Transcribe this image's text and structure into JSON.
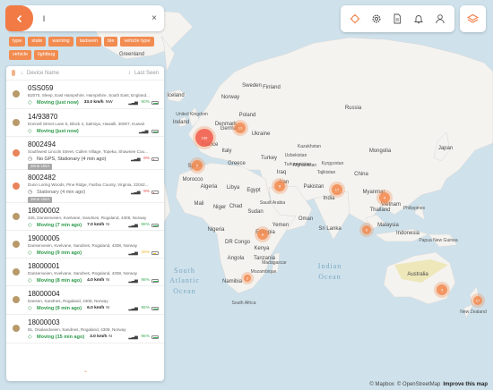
{
  "search": {
    "value": "l",
    "clear": "×"
  },
  "filters": [
    "type",
    "state",
    "warning",
    "lastseen",
    "ble",
    "vehicle type",
    "vehicle",
    "lightbug"
  ],
  "list_header": {
    "name": "Device Name",
    "last_seen": "Last Seen"
  },
  "devices": [
    {
      "id": "0SS059",
      "address": "B2070, Sleep, East Hampshire, Hampshire, South East, England...",
      "status": "Moving (just now)",
      "status_kind": "moving",
      "speed": "33.0 km/h",
      "heading": "NW",
      "battery": "90%",
      "battery_level": 0.9,
      "battery_color": "#3fae5a",
      "tag": ""
    },
    {
      "id": "14/93870",
      "address": "Donnell Street Lane 5, Block 4, Salmiya, Hawalli, 30007, Kuwait",
      "status": "Moving (just now)",
      "status_kind": "moving",
      "speed": "",
      "heading": "",
      "battery": "",
      "battery_level": 0.9,
      "battery_color": "#3fae5a",
      "tag": ""
    },
    {
      "id": "8002494",
      "address": "Southwest Lincoln Street, Cullen Village, Topeka, Shawnee Cou...",
      "status": "No GPS, Stationary (4 min ago)",
      "status_kind": "nogps",
      "speed": "",
      "heading": "",
      "battery": "9%",
      "battery_level": 0.12,
      "battery_color": "#e34a4a",
      "tag": "Jens USA"
    },
    {
      "id": "8002482",
      "address": "Dunn Loring Woods, Pine Ridge, Fairfax County, Virginia, 22042...",
      "status": "Stationary (4 min ago)",
      "status_kind": "stationary",
      "speed": "",
      "heading": "",
      "battery": "9%",
      "battery_level": 0.12,
      "battery_color": "#e34a4a",
      "tag": "Jens USA"
    },
    {
      "id": "18000002",
      "address": "345, Dansenveien, Kvelvane, Sandnes, Rogaland, 4308, Norway",
      "status": "Moving (7 min ago)",
      "status_kind": "moving",
      "speed": "7.0 km/h",
      "heading": "N",
      "battery": "98%",
      "battery_level": 0.98,
      "battery_color": "#3fae5a",
      "tag": ""
    },
    {
      "id": "19000005",
      "address": "Dansenveien, Kvelvane, Sandnes, Rogaland, 4308, Norway",
      "status": "Moving (9 min ago)",
      "status_kind": "moving",
      "speed": "",
      "heading": "",
      "battery": "49%",
      "battery_level": 0.49,
      "battery_color": "#f2b830",
      "tag": ""
    },
    {
      "id": "18000001",
      "address": "Dansenveien, Kvelvane, Sandnes, Rogaland, 4308, Norway",
      "status": "Moving (8 min ago)",
      "status_kind": "moving",
      "speed": "4.0 km/h",
      "heading": "N",
      "battery": "98%",
      "battery_level": 0.98,
      "battery_color": "#3fae5a",
      "tag": ""
    },
    {
      "id": "18000004",
      "address": "Dansen, Sandnes, Rogaland, 4308, Norway",
      "status": "Moving (9 min ago)",
      "status_kind": "moving",
      "speed": "6.0 km/h",
      "heading": "N",
      "battery": "96%",
      "battery_level": 0.96,
      "battery_color": "#3fae5a",
      "tag": ""
    },
    {
      "id": "18000003",
      "address": "91, Osalandveien, Sandnes, Rogaland, 4308, Norway",
      "status": "Moving (15 min ago)",
      "status_kind": "moving",
      "speed": "3.0 km/h",
      "heading": "N",
      "battery": "96%",
      "battery_level": 0.96,
      "battery_color": "#3fae5a",
      "tag": ""
    }
  ],
  "map": {
    "countries": [
      "Greenland",
      "Iceland",
      "Norway",
      "Sweden",
      "Finland",
      "Denmark",
      "Russia",
      "France",
      "Italy",
      "Greece",
      "Turkey",
      "Ukraine",
      "Kazakhstan",
      "Mongolia",
      "China",
      "Iran",
      "Afghanistan",
      "Pakistan",
      "India",
      "Algeria",
      "Libya",
      "Egypt",
      "Mali",
      "Niger",
      "Chad",
      "Sudan",
      "Nigeria",
      "Ethiopia",
      "Kenya",
      "Tanzania",
      "Angola",
      "Namibia",
      "Morocco",
      "Saudi Arabia",
      "Oman",
      "Sri Lanka",
      "Japan",
      "Indonesia",
      "Papua New Guinea",
      "Australia",
      "New Zealand",
      "Spain",
      "Yemen",
      "DR Congo",
      "Mozambique",
      "Madagascar",
      "South Africa",
      "Kyrgyzstan",
      "Tajikistan",
      "Myanmar",
      "Thailand",
      "Vietnam",
      "Philippines",
      "Malaysia",
      "Turkmenistan",
      "Uzbekistan",
      "Iraq",
      "Poland",
      "Germany",
      "United Kingdom",
      "Ireland"
    ],
    "oceans": [
      "South Atlantic Ocean",
      "Indian Ocean"
    ],
    "clusters": [
      "168",
      "13",
      "5",
      "8",
      "17",
      "8",
      "4",
      "5",
      "3",
      "17",
      "2",
      "5",
      "2"
    ]
  },
  "attribution": {
    "copy": "© Mapbox",
    "osm": "© OpenStreetMap",
    "improve": "Improve this map"
  },
  "colors": {
    "accent": "#f27a45",
    "cluster": "#f28b50",
    "moving": "#2e9a4a",
    "land": "#f2f0ec",
    "water": "#cfe2ec"
  }
}
